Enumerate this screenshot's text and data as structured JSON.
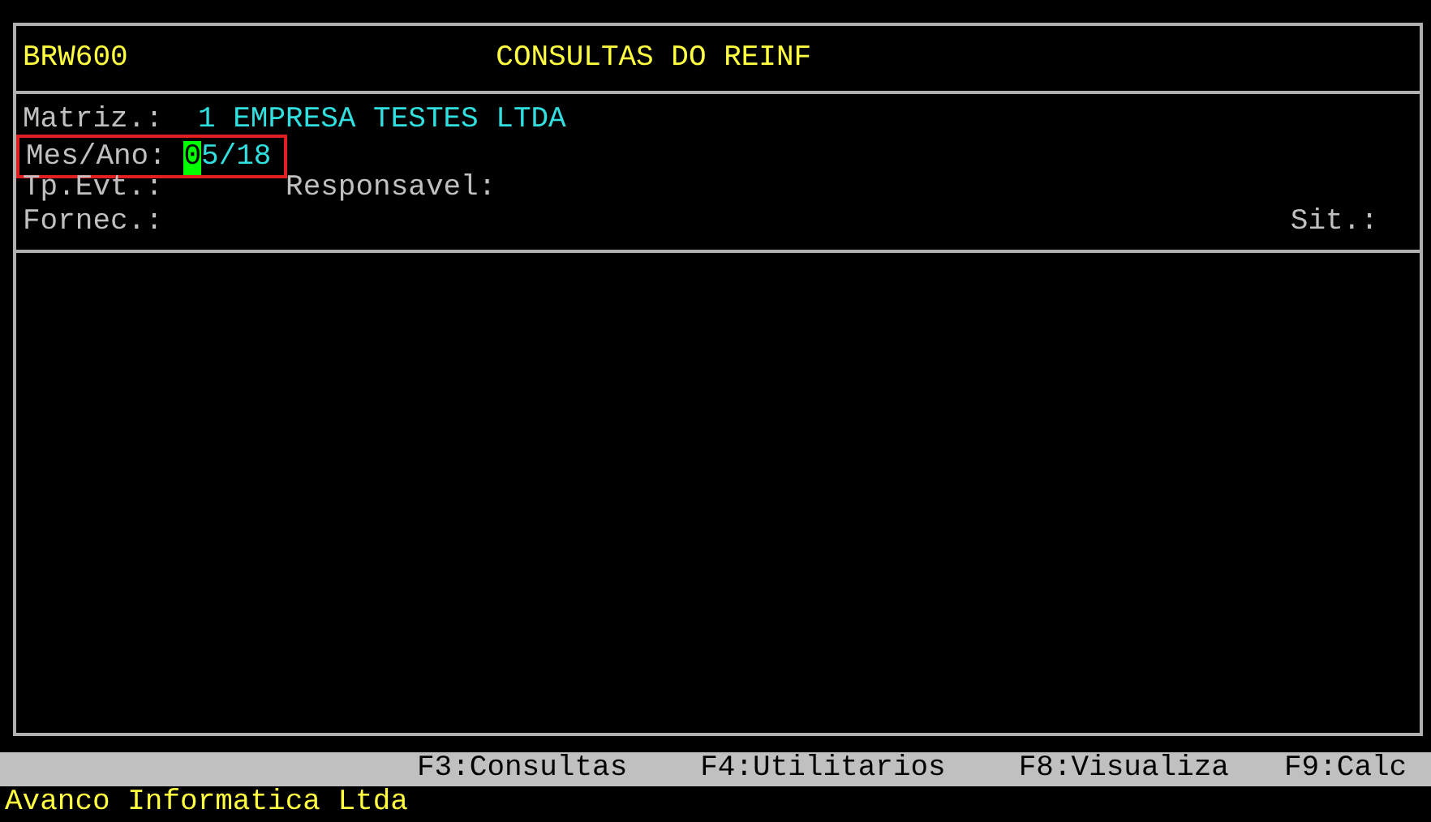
{
  "header": {
    "program": "BRW600",
    "title": "CONSULTAS DO REINF"
  },
  "fields": {
    "matriz": {
      "label": "Matriz.:",
      "value": "1 EMPRESA TESTES LTDA"
    },
    "mes_ano": {
      "label": "Mes/Ano:",
      "cursor_char": "0",
      "value": "5/18",
      "highlighted": true
    },
    "tp_evt": {
      "label": "Tp.Evt.:"
    },
    "responsavel": {
      "label": "Responsavel:"
    },
    "fornec": {
      "label": "Fornec.:"
    },
    "sit": {
      "label": "Sit.:"
    }
  },
  "function_keys": [
    "F3:Consultas",
    "F4:Utilitarios",
    "F8:Visualiza",
    "F9:Calc"
  ],
  "status_bar": "Avanco Informatica Ltda"
}
